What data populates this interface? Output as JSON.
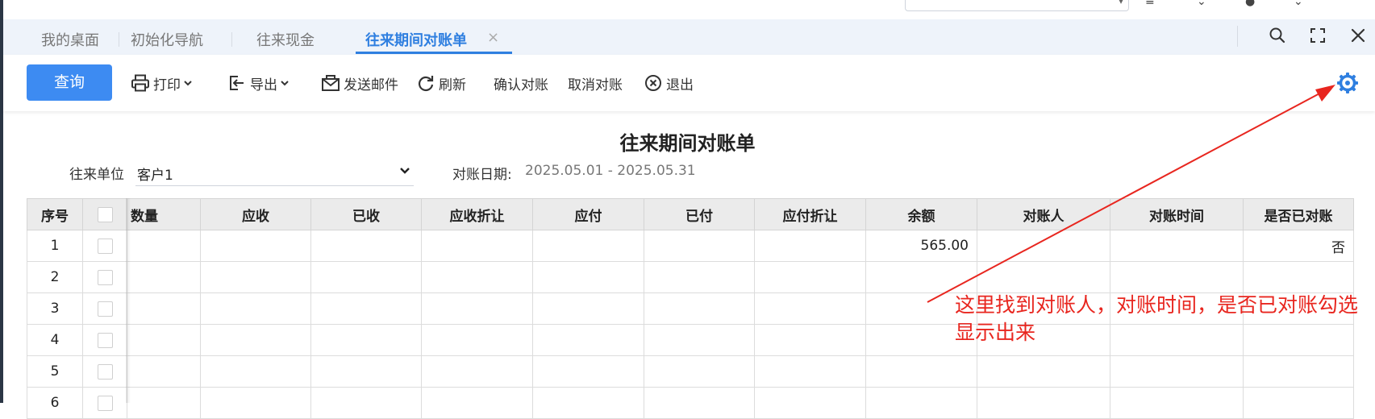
{
  "topbar": {
    "app_title": "",
    "app_subtitle": ""
  },
  "tabs": [
    {
      "label": "我的桌面",
      "active": false
    },
    {
      "label": "初始化导航",
      "active": false
    },
    {
      "label": "往来现金",
      "active": false
    },
    {
      "label": "往来期间对账单",
      "active": true
    }
  ],
  "toolbar": {
    "query": "查询",
    "print": "打印",
    "export": "导出",
    "send_email": "发送邮件",
    "refresh": "刷新",
    "confirm": "确认对账",
    "cancel_confirm": "取消对账",
    "exit": "退出"
  },
  "report": {
    "title": "往来期间对账单",
    "unit_label": "往来单位",
    "unit_value": "客户1",
    "date_label": "对账日期:",
    "date_range": "2025.05.01 - 2025.05.31"
  },
  "table": {
    "columns": [
      "序号",
      "",
      "数量",
      "应收",
      "已收",
      "应收折让",
      "应付",
      "已付",
      "应付折让",
      "余额",
      "对账人",
      "对账时间",
      "是否已对账"
    ],
    "rows": [
      {
        "no": "1",
        "qty": "",
        "receivable": "",
        "received": "",
        "recv_discount": "",
        "payable": "",
        "paid": "",
        "pay_discount": "",
        "balance": "565.00",
        "reconciler": "",
        "recon_time": "",
        "reconciled": "否"
      },
      {
        "no": "2",
        "qty": "",
        "receivable": "",
        "received": "",
        "recv_discount": "",
        "payable": "",
        "paid": "",
        "pay_discount": "",
        "balance": "",
        "reconciler": "",
        "recon_time": "",
        "reconciled": ""
      },
      {
        "no": "3",
        "qty": "",
        "receivable": "",
        "received": "",
        "recv_discount": "",
        "payable": "",
        "paid": "",
        "pay_discount": "",
        "balance": "",
        "reconciler": "",
        "recon_time": "",
        "reconciled": ""
      },
      {
        "no": "4",
        "qty": "",
        "receivable": "",
        "received": "",
        "recv_discount": "",
        "payable": "",
        "paid": "",
        "pay_discount": "",
        "balance": "",
        "reconciler": "",
        "recon_time": "",
        "reconciled": ""
      },
      {
        "no": "5",
        "qty": "",
        "receivable": "",
        "received": "",
        "recv_discount": "",
        "payable": "",
        "paid": "",
        "pay_discount": "",
        "balance": "",
        "reconciler": "",
        "recon_time": "",
        "reconciled": ""
      },
      {
        "no": "6",
        "qty": "",
        "receivable": "",
        "received": "",
        "recv_discount": "",
        "payable": "",
        "paid": "",
        "pay_discount": "",
        "balance": "",
        "reconciler": "",
        "recon_time": "",
        "reconciled": ""
      }
    ]
  },
  "annotation": {
    "text": "这里找到对账人，对账时间，是否已对账勾选显示出来",
    "color": "#e8261f"
  },
  "colors": {
    "accent": "#2f7fe0",
    "primary_button": "#3d8bf2"
  },
  "icons": [
    "print-icon",
    "export-icon",
    "mail-icon",
    "refresh-icon",
    "exit-icon",
    "settings-icon",
    "search-icon",
    "fullscreen-icon",
    "close-icon",
    "chevron-down-icon"
  ]
}
